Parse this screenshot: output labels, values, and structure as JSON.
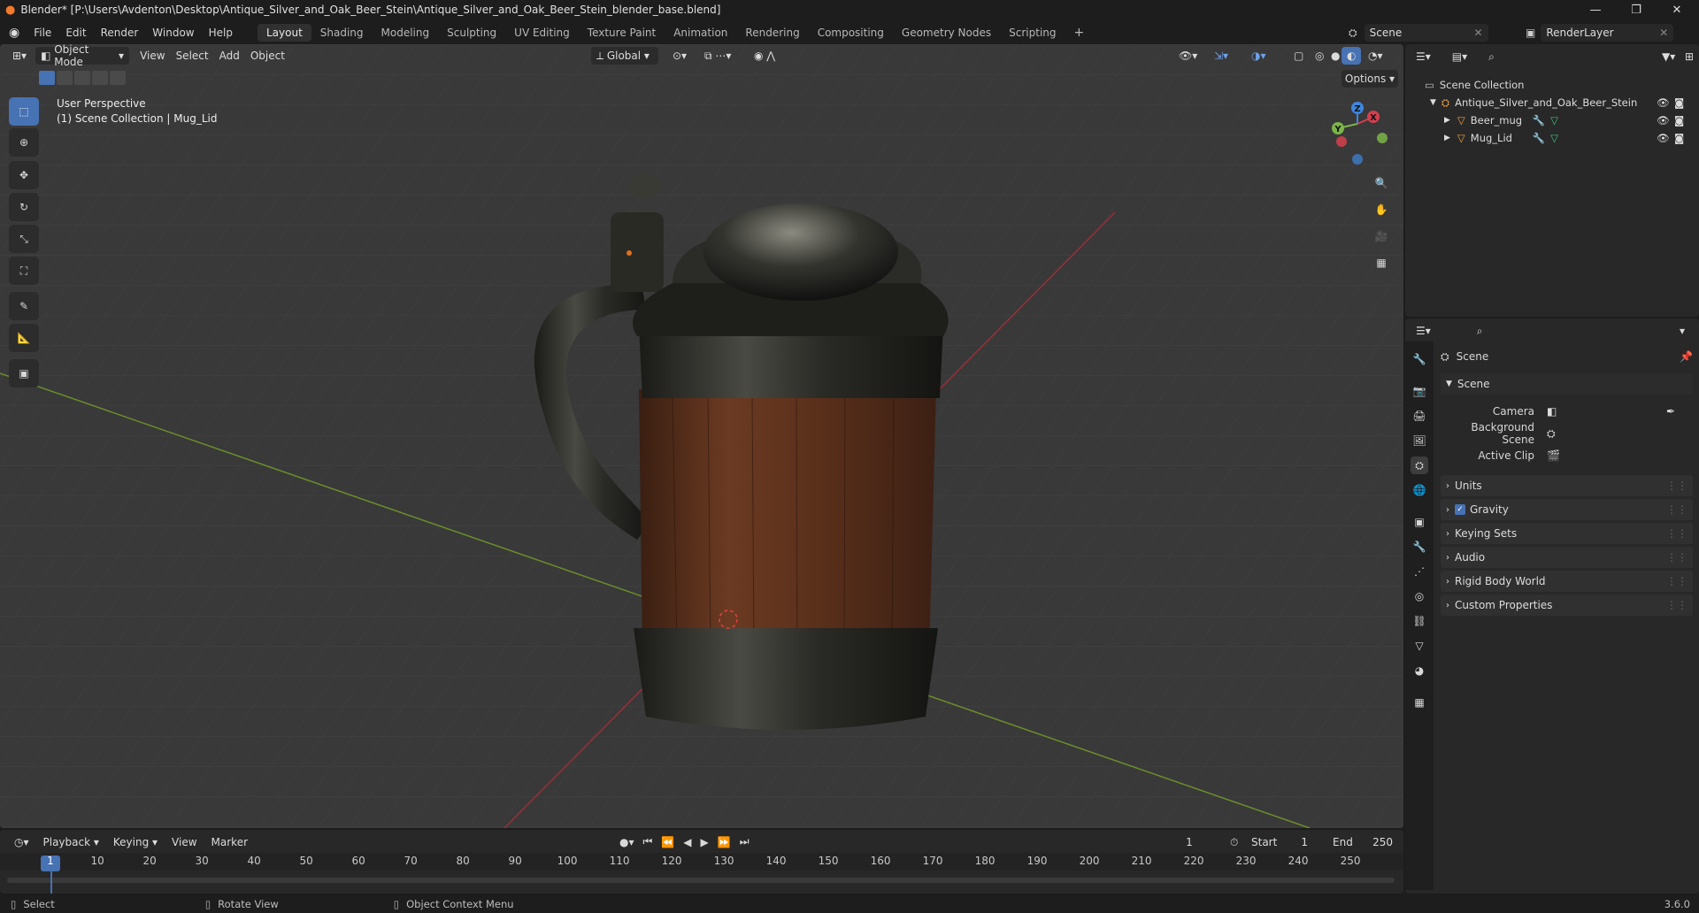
{
  "window": {
    "title": "Blender* [P:\\Users\\Avdenton\\Desktop\\Antique_Silver_and_Oak_Beer_Stein\\Antique_Silver_and_Oak_Beer_Stein_blender_base.blend]",
    "version": "3.6.0"
  },
  "menus": [
    "File",
    "Edit",
    "Render",
    "Window",
    "Help"
  ],
  "workspaces": [
    "Layout",
    "Shading",
    "Modeling",
    "Sculpting",
    "UV Editing",
    "Texture Paint",
    "Animation",
    "Rendering",
    "Compositing",
    "Geometry Nodes",
    "Scripting"
  ],
  "active_workspace": "Layout",
  "scene_name": "Scene",
  "render_layer": "RenderLayer",
  "viewport": {
    "mode": "Object Mode",
    "menus": [
      "View",
      "Select",
      "Add",
      "Object"
    ],
    "orientation": "Global",
    "options_label": "Options",
    "info_line1": "User Perspective",
    "info_line2": "(1) Scene Collection | Mug_Lid",
    "gizmo": {
      "x": "X",
      "y": "Y",
      "z": "Z"
    }
  },
  "outliner": {
    "root": "Scene Collection",
    "collection": "Antique_Silver_and_Oak_Beer_Stein",
    "objects": [
      "Beer_mug",
      "Mug_Lid"
    ]
  },
  "properties": {
    "header": "Scene",
    "section": "Scene",
    "fields": [
      {
        "label": "Camera"
      },
      {
        "label": "Background Scene"
      },
      {
        "label": "Active Clip"
      }
    ],
    "panels": [
      "Units",
      "Gravity",
      "Keying Sets",
      "Audio",
      "Rigid Body World",
      "Custom Properties"
    ],
    "gravity_checked": true
  },
  "timeline": {
    "menus": [
      "Playback",
      "Keying",
      "View",
      "Marker"
    ],
    "current_frame": "1",
    "start_label": "Start",
    "start": "1",
    "end_label": "End",
    "end": "250",
    "ticks": [
      "1",
      "10",
      "20",
      "30",
      "40",
      "50",
      "60",
      "70",
      "80",
      "90",
      "100",
      "110",
      "120",
      "130",
      "140",
      "150",
      "160",
      "170",
      "180",
      "190",
      "200",
      "210",
      "220",
      "230",
      "240",
      "250"
    ]
  },
  "status": {
    "select": "Select",
    "rotate": "Rotate View",
    "context": "Object Context Menu"
  },
  "colors": {
    "accent": "#4772b3",
    "x_axis": "#d63f4e",
    "y_axis": "#7cb548",
    "z_axis": "#3f86de",
    "bg": "#1d1d1d"
  }
}
